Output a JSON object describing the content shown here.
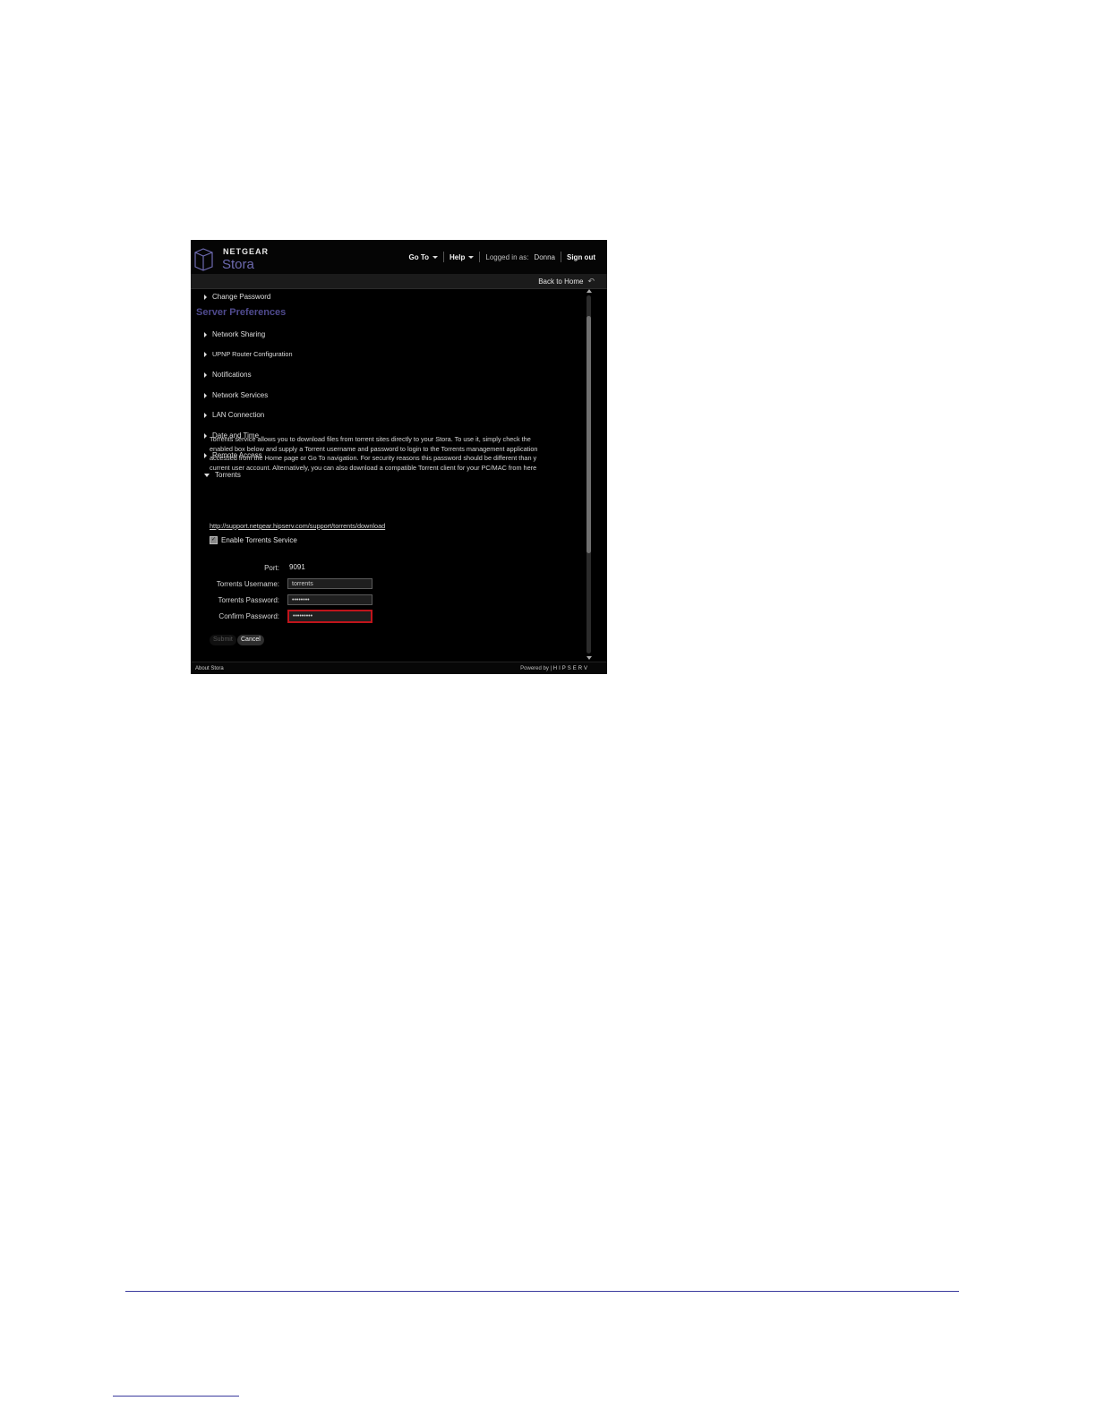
{
  "header": {
    "brand_top": "NETGEAR",
    "brand_bottom": "Stora",
    "goto_label": "Go To",
    "help_label": "Help",
    "logged_in_label": "Logged in as:",
    "username": "Donna",
    "signout_label": "Sign out"
  },
  "subbar": {
    "back_home_label": "Back to Home"
  },
  "menu": {
    "change_password": "Change Password",
    "section_title": "Server Preferences",
    "items": [
      "Network Sharing",
      "UPNP Router Configuration",
      "Notifications",
      "Network Services",
      "LAN Connection",
      "Date and Time",
      "Remote Access",
      "Torrents"
    ]
  },
  "torrents": {
    "description_lines": [
      "Torrents service allows you to download files from torrent sites directly to your Stora. To use it, simply check the",
      "enabled box below and supply a Torrent username and password to login to the Torrents management application",
      "accessed from the Home page or Go To navigation. For security reasons this password should be different than y",
      "current user account. Alternatively, you can also download a compatible Torrent client for your PC/MAC from here"
    ],
    "link": "http://support.netgear.hipserv.com/support/torrents/download",
    "enable_label": "Enable Torrents Service",
    "port_label": "Port:",
    "port_value": "9091",
    "username_label": "Torrents Username:",
    "username_value": "torrents",
    "password_label": "Torrents Password:",
    "password_value": "••••••••",
    "confirm_label": "Confirm Password:",
    "confirm_value": "•••••••••",
    "submit_label": "Submit",
    "cancel_label": "Cancel"
  },
  "footer": {
    "about_label": "About Stora",
    "powered_label": "Powered by",
    "powered_brand": "HIPSERV"
  },
  "colors": {
    "section_title": "#4f4a8e",
    "error_border": "#c0141b",
    "page_rule": "#3b3b9e"
  }
}
